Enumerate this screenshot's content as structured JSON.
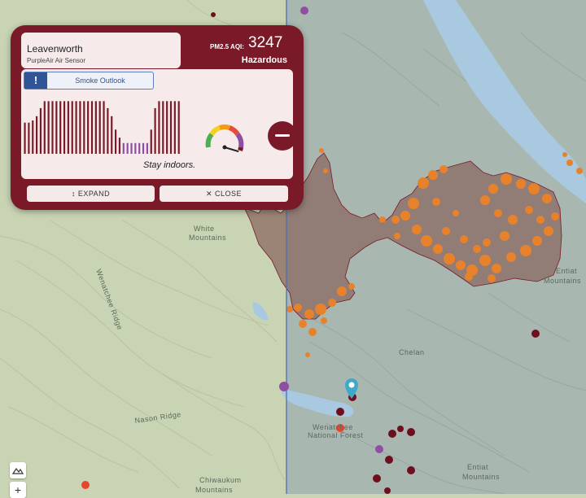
{
  "map": {
    "labels": {
      "white_mountains": "White",
      "white_mountains_2": "Mountains",
      "entiat_mountains": "Entiat",
      "entiat_mountains_2": "Mountains",
      "chelan": "Chelan",
      "wenatchee_national_forest": "Wenatchee",
      "wenatchee_national_forest_2": "National Forest",
      "nason_ridge": "Nason Ridge",
      "chiwaukum_mountains": "Chiwaukum",
      "chiwaukum_mountains_2": "Mountains",
      "entiat_lower": "Entiat",
      "entiat_lower_2": "Mountains",
      "ridge_left": "Wenatchee Ridge"
    },
    "colors": {
      "terrain_left": "#c9d4b4",
      "terrain_right": "#aab8b4",
      "water": "#a9c9e1",
      "fire_perimeter": "#8a5a52",
      "hotspot": "#e8822a",
      "sensor_hazardous": "#6e0f1e",
      "sensor_purple": "#8e4fa2",
      "sensor_red": "#e8452f"
    }
  },
  "popup": {
    "location": "Leavenworth",
    "source": "PurpleAir Air Sensor",
    "aqi_label": "PM2.5 AQI:",
    "aqi_value": "3247",
    "aqi_status": "Hazardous",
    "outlook_icon": "!",
    "outlook_label": "Smoke Outlook",
    "advice": "Stay indoors.",
    "expand_label": "EXPAND",
    "close_label": "CLOSE",
    "expand_icon": "expand-arrows-icon",
    "close_icon": "close-x-icon",
    "history_bars": [
      0.58,
      0.58,
      0.62,
      0.7,
      0.85,
      0.98,
      0.98,
      0.98,
      0.98,
      0.98,
      0.98,
      0.98,
      0.98,
      0.98,
      0.98,
      0.98,
      0.98,
      0.98,
      0.98,
      0.98,
      0.98,
      0.85,
      0.7,
      0.45,
      0.3,
      0.2,
      0.2,
      0.2,
      0.2,
      0.2,
      0.2,
      0.2,
      0.45,
      0.85,
      0.98,
      0.98,
      0.98,
      0.98,
      0.98,
      0.98
    ],
    "history_colors": [
      "#7a1a28",
      "#7a1a28",
      "#7a1a28",
      "#7a1a28",
      "#7a1a28",
      "#7a1a28",
      "#7a1a28",
      "#7a1a28",
      "#7a1a28",
      "#7a1a28",
      "#7a1a28",
      "#7a1a28",
      "#7a1a28",
      "#7a1a28",
      "#7a1a28",
      "#7a1a28",
      "#7a1a28",
      "#7a1a28",
      "#7a1a28",
      "#7a1a28",
      "#7a1a28",
      "#7a1a28",
      "#7a1a28",
      "#7a1a28",
      "#7a1a28",
      "#8e4fa2",
      "#8e4fa2",
      "#8e4fa2",
      "#8e4fa2",
      "#8e4fa2",
      "#8e4fa2",
      "#8e4fa2",
      "#7a1a28",
      "#7a1a28",
      "#7a1a28",
      "#7a1a28",
      "#7a1a28",
      "#7a1a28",
      "#7a1a28",
      "#7a1a28"
    ],
    "gauge_level": 0.95
  },
  "controls": {
    "terrain_icon": "terrain-icon",
    "zoom_in": "+"
  }
}
